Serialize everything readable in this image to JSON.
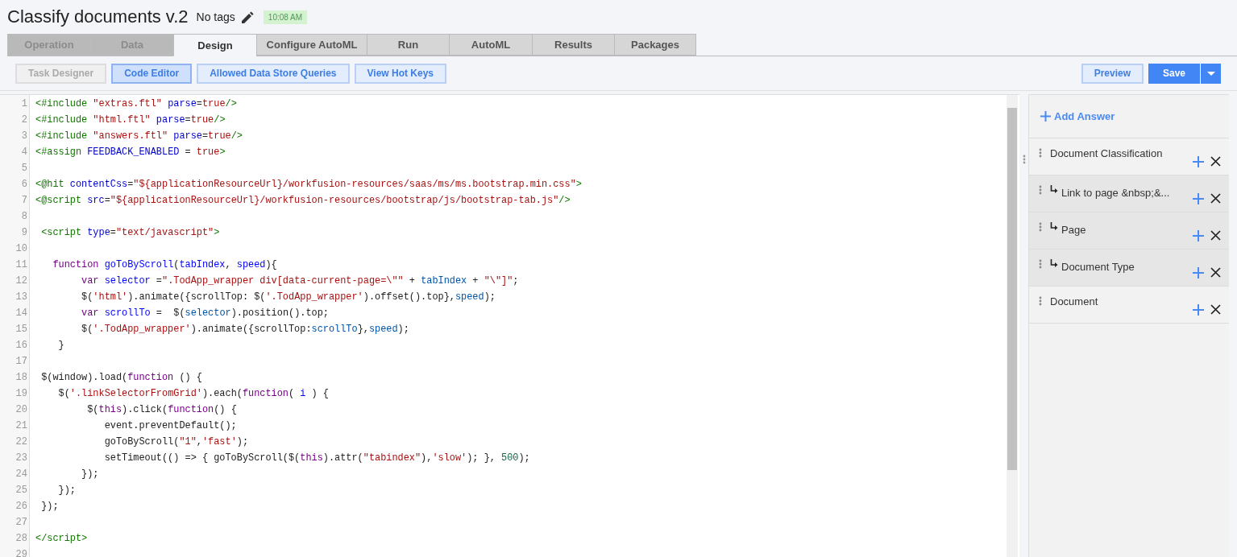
{
  "title": "Classify documents v.2",
  "tags": "No tags",
  "time": "10:08 AM",
  "tabs": [
    {
      "label": "Operation",
      "selected": false,
      "disabled": true
    },
    {
      "label": "Data",
      "selected": false,
      "disabled": true
    },
    {
      "label": "Design",
      "selected": true,
      "disabled": false
    },
    {
      "label": "Configure AutoML",
      "selected": false,
      "disabled": false
    },
    {
      "label": "Run",
      "selected": false,
      "disabled": false
    },
    {
      "label": "AutoML",
      "selected": false,
      "disabled": false
    },
    {
      "label": "Results",
      "selected": false,
      "disabled": false
    },
    {
      "label": "Packages",
      "selected": false,
      "disabled": false
    }
  ],
  "toolbar": [
    {
      "label": "Task Designer",
      "selected": false,
      "disabled": true
    },
    {
      "label": "Code Editor",
      "selected": true,
      "disabled": false
    },
    {
      "label": "Allowed Data Store Queries",
      "selected": false,
      "disabled": false
    },
    {
      "label": "View Hot Keys",
      "selected": false,
      "disabled": false
    }
  ],
  "actions": {
    "preview": "Preview",
    "save": "Save"
  },
  "editor": {
    "lines": [
      {
        "n": "1",
        "tokens": [
          {
            "kind": "tag",
            "text": "<#include"
          },
          {
            "kind": "str",
            "text": " \"extras.ftl\""
          },
          {
            "kind": "attr",
            "text": " parse"
          },
          {
            "kind": "plain",
            "text": "="
          },
          {
            "kind": "atom",
            "text": "true"
          },
          {
            "kind": "tag",
            "text": "/>"
          }
        ]
      },
      {
        "n": "2",
        "tokens": [
          {
            "kind": "tag",
            "text": "<#include"
          },
          {
            "kind": "str",
            "text": " \"html.ftl\""
          },
          {
            "kind": "attr",
            "text": " parse"
          },
          {
            "kind": "plain",
            "text": "="
          },
          {
            "kind": "atom",
            "text": "true"
          },
          {
            "kind": "tag",
            "text": "/>"
          }
        ]
      },
      {
        "n": "3",
        "tokens": [
          {
            "kind": "tag",
            "text": "<#include"
          },
          {
            "kind": "str",
            "text": " \"answers.ftl\""
          },
          {
            "kind": "attr",
            "text": " parse"
          },
          {
            "kind": "plain",
            "text": "="
          },
          {
            "kind": "atom",
            "text": "true"
          },
          {
            "kind": "tag",
            "text": "/>"
          }
        ]
      },
      {
        "n": "4",
        "tokens": [
          {
            "kind": "tag",
            "text": "<#assign"
          },
          {
            "kind": "attr",
            "text": " FEEDBACK_ENABLED"
          },
          {
            "kind": "plain",
            "text": " ="
          },
          {
            "kind": "atom",
            "text": " true"
          },
          {
            "kind": "tag",
            "text": ">"
          }
        ]
      },
      {
        "n": "5"
      },
      {
        "n": "6",
        "tokens": [
          {
            "kind": "tag",
            "text": "<@hit"
          },
          {
            "kind": "attr",
            "text": " contentCss"
          },
          {
            "kind": "plain",
            "text": "="
          },
          {
            "kind": "str",
            "text": "\"${applicationResourceUrl}/workfusion-resources/saas/ms/ms.bootstrap.min.css\""
          },
          {
            "kind": "tag",
            "text": ">"
          }
        ]
      },
      {
        "n": "7",
        "tokens": [
          {
            "kind": "tag",
            "text": "<@script"
          },
          {
            "kind": "attr",
            "text": " src"
          },
          {
            "kind": "plain",
            "text": "="
          },
          {
            "kind": "str",
            "text": "\"${applicationResourceUrl}/workfusion-resources/bootstrap/js/bootstrap-tab.js\""
          },
          {
            "kind": "tag",
            "text": "/>"
          }
        ]
      },
      {
        "n": "8"
      },
      {
        "n": "9",
        "tokens": [
          {
            "kind": "tag",
            "text": " <script"
          },
          {
            "kind": "attr",
            "text": " type"
          },
          {
            "kind": "plain",
            "text": "="
          },
          {
            "kind": "str",
            "text": "\"text/javascript\""
          },
          {
            "kind": "tag",
            "text": ">"
          }
        ]
      },
      {
        "n": "10"
      },
      {
        "n": "11",
        "tokens": [
          {
            "kind": "kw",
            "text": "   function"
          },
          {
            "kind": "def",
            "text": " goToByScroll"
          },
          {
            "kind": "plain",
            "text": "("
          },
          {
            "kind": "def",
            "text": "tabIndex"
          },
          {
            "kind": "plain",
            "text": ","
          },
          {
            "kind": "def",
            "text": " speed"
          },
          {
            "kind": "plain",
            "text": "){"
          }
        ]
      },
      {
        "n": "12",
        "tokens": [
          {
            "kind": "kw",
            "text": "        var"
          },
          {
            "kind": "def",
            "text": " selector"
          },
          {
            "kind": "plain",
            "text": " ="
          },
          {
            "kind": "str",
            "text": "\".TodApp_wrapper div[data-current-page=\\\"\""
          },
          {
            "kind": "plain",
            "text": " +"
          },
          {
            "kind": "var",
            "text": " tabIndex"
          },
          {
            "kind": "plain",
            "text": " +"
          },
          {
            "kind": "str",
            "text": " \"\\\"]\""
          },
          {
            "kind": "plain",
            "text": ";"
          }
        ]
      },
      {
        "n": "13",
        "tokens": [
          {
            "kind": "plain",
            "text": "        $("
          },
          {
            "kind": "str",
            "text": "'html'"
          },
          {
            "kind": "plain",
            "text": ").animate({scrollTop: $("
          },
          {
            "kind": "str",
            "text": "'.TodApp_wrapper'"
          },
          {
            "kind": "plain",
            "text": ").offset().top},"
          },
          {
            "kind": "var",
            "text": "speed"
          },
          {
            "kind": "plain",
            "text": ");"
          }
        ]
      },
      {
        "n": "14",
        "tokens": [
          {
            "kind": "kw",
            "text": "        var"
          },
          {
            "kind": "def",
            "text": " scrollTo"
          },
          {
            "kind": "plain",
            "text": " =  $("
          },
          {
            "kind": "var",
            "text": "selector"
          },
          {
            "kind": "plain",
            "text": ").position().top;"
          }
        ]
      },
      {
        "n": "15",
        "tokens": [
          {
            "kind": "plain",
            "text": "        $("
          },
          {
            "kind": "str",
            "text": "'.TodApp_wrapper'"
          },
          {
            "kind": "plain",
            "text": ").animate({scrollTop:"
          },
          {
            "kind": "var",
            "text": "scrollTo"
          },
          {
            "kind": "plain",
            "text": "},"
          },
          {
            "kind": "var",
            "text": "speed"
          },
          {
            "kind": "plain",
            "text": ");"
          }
        ]
      },
      {
        "n": "16",
        "tokens": [
          {
            "kind": "plain",
            "text": "    }"
          }
        ]
      },
      {
        "n": "17"
      },
      {
        "n": "18",
        "tokens": [
          {
            "kind": "plain",
            "text": " $(window).load("
          },
          {
            "kind": "kw",
            "text": "function"
          },
          {
            "kind": "plain",
            "text": " () {"
          }
        ]
      },
      {
        "n": "19",
        "tokens": [
          {
            "kind": "plain",
            "text": "    $("
          },
          {
            "kind": "str",
            "text": "'.linkSelectorFromGrid'"
          },
          {
            "kind": "plain",
            "text": ").each("
          },
          {
            "kind": "kw",
            "text": "function"
          },
          {
            "kind": "plain",
            "text": "("
          },
          {
            "kind": "def",
            "text": " i"
          },
          {
            "kind": "plain",
            "text": " ) {"
          }
        ]
      },
      {
        "n": "20",
        "tokens": [
          {
            "kind": "plain",
            "text": "         $("
          },
          {
            "kind": "kw",
            "text": "this"
          },
          {
            "kind": "plain",
            "text": ").click("
          },
          {
            "kind": "kw",
            "text": "function"
          },
          {
            "kind": "plain",
            "text": "() {"
          }
        ]
      },
      {
        "n": "21",
        "tokens": [
          {
            "kind": "plain",
            "text": "            event.preventDefault();"
          }
        ]
      },
      {
        "n": "22",
        "tokens": [
          {
            "kind": "plain",
            "text": "            goToByScroll("
          },
          {
            "kind": "str",
            "text": "\"1\""
          },
          {
            "kind": "plain",
            "text": ","
          },
          {
            "kind": "str",
            "text": "'fast'"
          },
          {
            "kind": "plain",
            "text": ");"
          }
        ]
      },
      {
        "n": "23",
        "tokens": [
          {
            "kind": "plain",
            "text": "            setTimeout(() => { goToByScroll($("
          },
          {
            "kind": "kw",
            "text": "this"
          },
          {
            "kind": "plain",
            "text": ").attr("
          },
          {
            "kind": "str",
            "text": "\"tabindex\""
          },
          {
            "kind": "plain",
            "text": "),"
          },
          {
            "kind": "str",
            "text": "'slow'"
          },
          {
            "kind": "plain",
            "text": "); },"
          },
          {
            "kind": "num",
            "text": " 500"
          },
          {
            "kind": "plain",
            "text": ");"
          }
        ]
      },
      {
        "n": "24",
        "tokens": [
          {
            "kind": "plain",
            "text": "        });"
          }
        ]
      },
      {
        "n": "25",
        "tokens": [
          {
            "kind": "plain",
            "text": "    });"
          }
        ]
      },
      {
        "n": "26",
        "tokens": [
          {
            "kind": "plain",
            "text": " });"
          }
        ]
      },
      {
        "n": "27"
      },
      {
        "n": "28",
        "tokens": [
          {
            "kind": "tag",
            "text": "</script>"
          }
        ]
      },
      {
        "n": "29"
      }
    ]
  },
  "answers": {
    "add": "Add Answer",
    "items": [
      {
        "label": "Document Classification",
        "children": [
          {
            "label": "Link to page &nbsp;&..."
          },
          {
            "label": "Page"
          },
          {
            "label": "Document Type"
          }
        ]
      },
      {
        "label": "Document"
      }
    ]
  }
}
